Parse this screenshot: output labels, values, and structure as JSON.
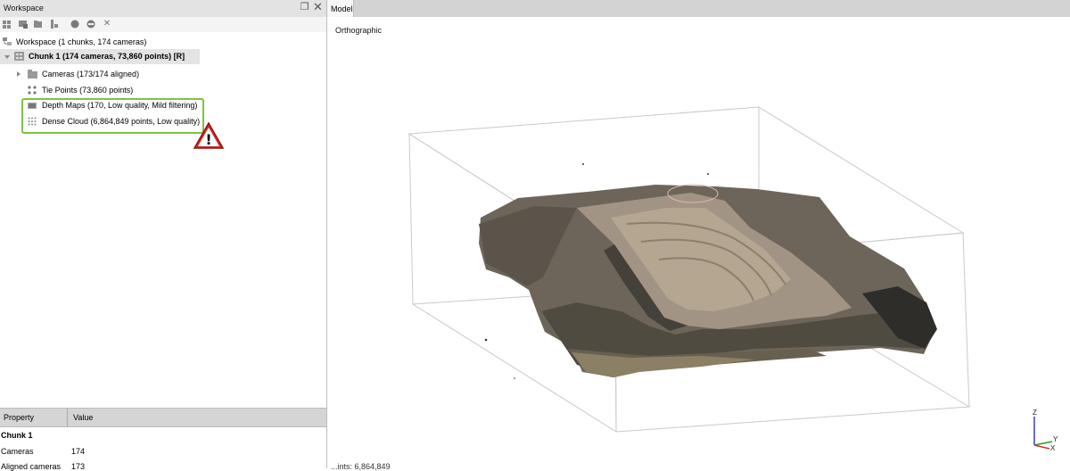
{
  "workspace": {
    "title": "Workspace",
    "float_icon": "restore-window-icon",
    "close_icon": "close-icon",
    "toolbar": [
      {
        "name": "add-chunk-icon"
      },
      {
        "name": "add-photos-icon"
      },
      {
        "name": "add-folder-icon"
      },
      {
        "name": "remove-items-icon"
      },
      {
        "name": "enable-icon"
      },
      {
        "name": "disable-icon"
      },
      {
        "name": "delete-icon",
        "glyph": "✕"
      }
    ],
    "tree": {
      "root": "Workspace (1 chunks, 174 cameras)",
      "chunk": "Chunk 1 (174 cameras, 73,860 points) [R]",
      "cameras": "Cameras (173/174 aligned)",
      "tie_points": "Tie Points (73,860 points)",
      "depth_maps": "Depth Maps (170, Low quality, Mild filtering)",
      "dense_cloud": "Dense Cloud (6,864,849 points, Low quality)"
    },
    "warning_icon": "warning-icon",
    "warning_glyph": "!"
  },
  "properties": {
    "col_property": "Property",
    "col_value": "Value",
    "section": "Chunk 1",
    "rows": [
      {
        "key": "Cameras",
        "value": "174"
      },
      {
        "key": "Aligned cameras",
        "value": "173"
      }
    ]
  },
  "model": {
    "tab": "Model",
    "projection": "Orthographic",
    "status": "...ints: 6,864,849",
    "axis": {
      "z": "Z",
      "y": "Y",
      "x": "X"
    }
  },
  "colors": {
    "highlight": "#7cc441",
    "warning_fill": "#d42a2a",
    "panel_header": "#e3e3e3",
    "tree_selected": "#e4e4e4"
  }
}
